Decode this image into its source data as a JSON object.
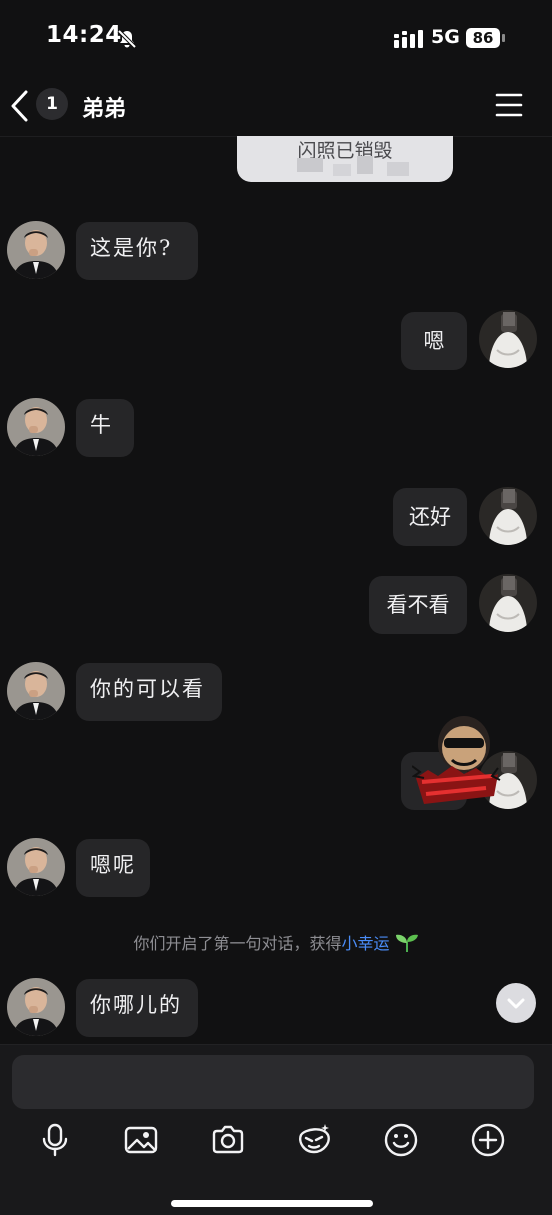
{
  "status": {
    "time": "14:24",
    "network": "5G",
    "battery": "86"
  },
  "header": {
    "unread_count": "1",
    "title": "弟弟"
  },
  "flash_notice": "闪照已销毁",
  "messages": [
    {
      "from": "them",
      "text": "这是你?"
    },
    {
      "from": "me",
      "text": "嗯"
    },
    {
      "from": "them",
      "text": "牛"
    },
    {
      "from": "me",
      "text": "还好"
    },
    {
      "from": "me",
      "text": "看不看"
    },
    {
      "from": "them",
      "text": "你的可以看"
    },
    {
      "from": "me",
      "text": ""
    },
    {
      "from": "them",
      "text": "嗯呢"
    },
    {
      "from": "them",
      "text": "你哪儿的"
    }
  ],
  "system_note": {
    "prefix": "你们开启了第一句对话，获得",
    "highlight": "小幸运"
  },
  "input": {
    "placeholder": ""
  },
  "toolbar": [
    "mic-icon",
    "image-icon",
    "camera-icon",
    "sticker-icon",
    "emoji-icon",
    "plus-icon"
  ]
}
